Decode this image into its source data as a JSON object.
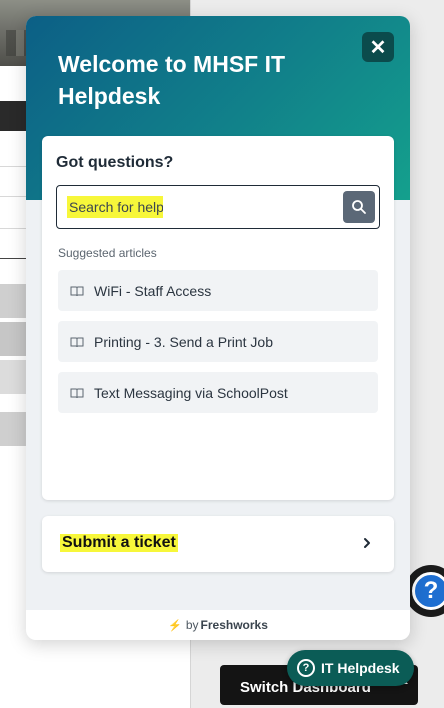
{
  "widget": {
    "title": "Welcome to MHSF IT Helpdesk",
    "close_label": "✕",
    "search_card": {
      "heading": "Got questions?",
      "search_placeholder": "Search for help",
      "suggested_heading": "Suggested articles",
      "articles": [
        {
          "label": "WiFi - Staff Access",
          "icon": "book-icon"
        },
        {
          "label": "Printing - 3. Send a Print Job",
          "icon": "book-icon"
        },
        {
          "label": "Text Messaging via SchoolPost",
          "icon": "book-icon"
        }
      ]
    },
    "ticket": {
      "label": "Submit a ticket",
      "icon": "chevron-right-icon"
    },
    "footer": {
      "by_text": "by",
      "brand": "Freshworks"
    }
  },
  "launcher": {
    "label": "IT Helpdesk",
    "icon": "question-circle-icon"
  },
  "page": {
    "switch_button_label": "Switch Dashboard",
    "help_fab_symbol": "?"
  },
  "colors": {
    "hero_start": "#0c5f86",
    "hero_end": "#14a08d",
    "highlight": "#f7f73a",
    "launcher": "#0b5c56"
  }
}
